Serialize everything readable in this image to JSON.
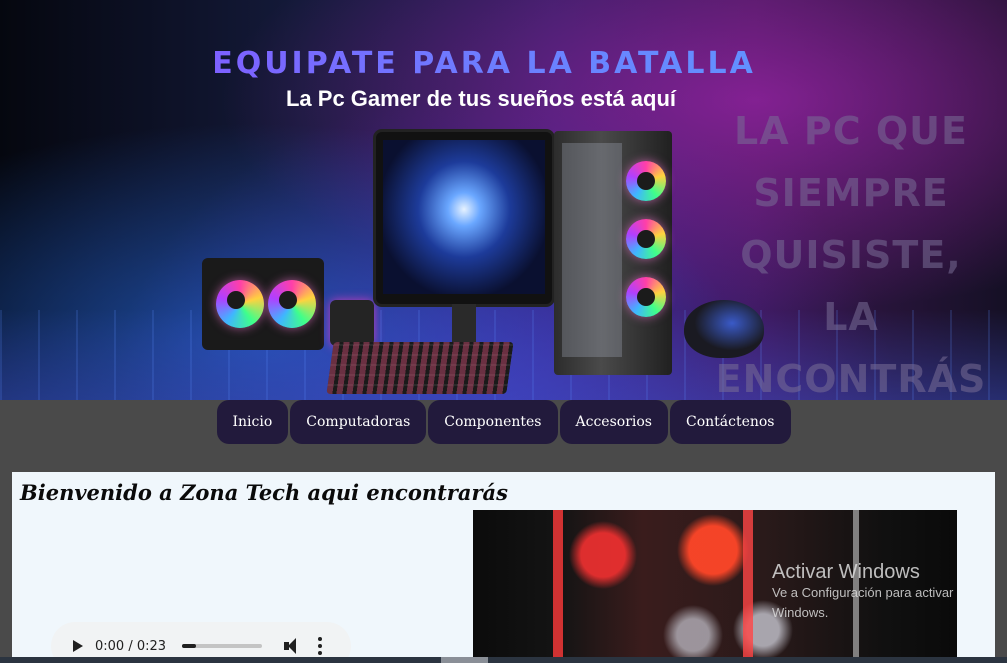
{
  "hero": {
    "title": "EQUIPATE PARA LA BATALLA",
    "subtitle": "La Pc Gamer de tus sueños está aquí",
    "ghost_lines": [
      "LA PC QUE",
      "SIEMPRE QUISISTE,",
      "LA ENCONTRÁS ACÁ"
    ]
  },
  "nav": {
    "items": [
      {
        "label": "Inicio"
      },
      {
        "label": "Computadoras"
      },
      {
        "label": "Componentes"
      },
      {
        "label": "Accesorios"
      },
      {
        "label": "Contáctenos"
      }
    ]
  },
  "content": {
    "welcome": "Bienvenido a Zona Tech aqui encontrarás",
    "audio": {
      "time": "0:00 / 0:23",
      "progress": 0.18
    }
  },
  "watermark": {
    "title": "Activar Windows",
    "subtitle": "Ve a Configuración para activar Windows."
  },
  "colors": {
    "nav_bg": "#221a3c",
    "page_bg": "#4a4a4a",
    "content_bg": "#f0f7fc"
  }
}
